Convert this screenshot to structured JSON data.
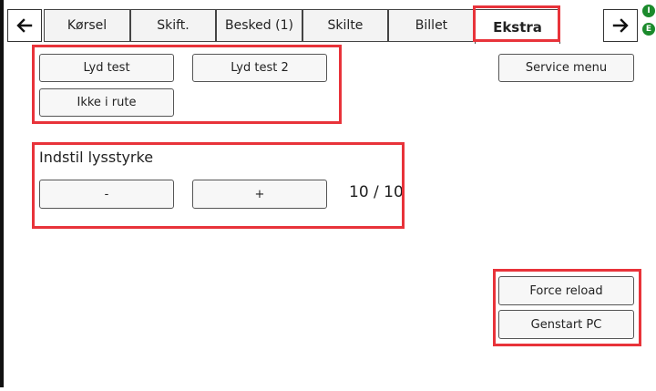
{
  "tabs": [
    {
      "label": "Kørsel"
    },
    {
      "label": "Skift."
    },
    {
      "label": "Besked (1)"
    },
    {
      "label": "Skilte"
    },
    {
      "label": "Billet"
    },
    {
      "label": "Ekstra",
      "active": true
    }
  ],
  "nav": {
    "back_icon": "arrow-left-icon",
    "forward_icon": "arrow-right-icon"
  },
  "status": {
    "dot1": "I",
    "dot2": "E",
    "color": "#1b8a2c"
  },
  "sound": {
    "test_label": "Lyd test",
    "test2_label": "Lyd test 2",
    "not_in_route_label": "Ikke i rute"
  },
  "service_menu_label": "Service menu",
  "brightness": {
    "heading": "Indstil lysstyrke",
    "minus_label": "-",
    "plus_label": "+",
    "value": "10 / 10"
  },
  "system": {
    "force_reload_label": "Force reload",
    "restart_label": "Genstart PC"
  },
  "highlight_color": "#e8333a"
}
